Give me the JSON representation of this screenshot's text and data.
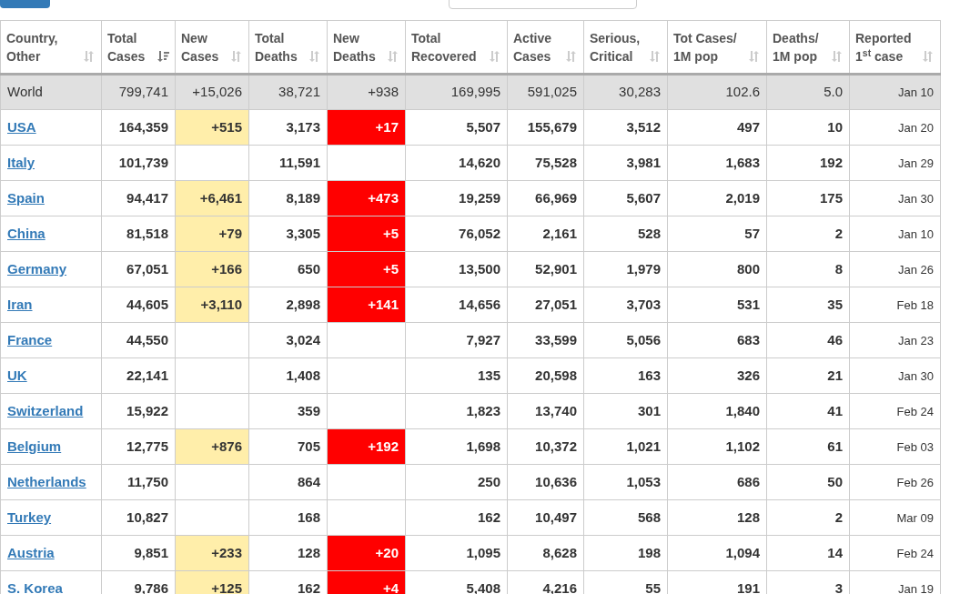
{
  "table": {
    "columns": [
      {
        "label": "Country,\nOther",
        "sorted": false
      },
      {
        "label": "Total\nCases",
        "sorted": true
      },
      {
        "label": "New\nCases",
        "sorted": false
      },
      {
        "label": "Total\nDeaths",
        "sorted": false
      },
      {
        "label": "New\nDeaths",
        "sorted": false
      },
      {
        "label": "Total\nRecovered",
        "sorted": false
      },
      {
        "label": "Active\nCases",
        "sorted": false
      },
      {
        "label": "Serious,\nCritical",
        "sorted": false
      },
      {
        "label": "Tot Cases/\n1M pop",
        "sorted": false
      },
      {
        "label": "Deaths/\n1M pop",
        "sorted": false
      },
      {
        "label": "Reported\n1$^{st}$ case",
        "sorted": false
      }
    ],
    "rows": [
      {
        "kind": "total",
        "cells": [
          "World",
          "799,741",
          "+15,026",
          "38,721",
          "+938",
          "169,995",
          "591,025",
          "30,283",
          "102.6",
          "5.0",
          "Jan 10"
        ]
      },
      {
        "kind": "country",
        "cells": [
          "USA",
          "164,359",
          "+515",
          "3,173",
          "+17",
          "5,507",
          "155,679",
          "3,512",
          "497",
          "10",
          "Jan 20"
        ]
      },
      {
        "kind": "country",
        "cells": [
          "Italy",
          "101,739",
          null,
          "11,591",
          null,
          "14,620",
          "75,528",
          "3,981",
          "1,683",
          "192",
          "Jan 29"
        ]
      },
      {
        "kind": "country",
        "cells": [
          "Spain",
          "94,417",
          "+6,461",
          "8,189",
          "+473",
          "19,259",
          "66,969",
          "5,607",
          "2,019",
          "175",
          "Jan 30"
        ]
      },
      {
        "kind": "country",
        "cells": [
          "China",
          "81,518",
          "+79",
          "3,305",
          "+5",
          "76,052",
          "2,161",
          "528",
          "57",
          "2",
          "Jan 10"
        ]
      },
      {
        "kind": "country",
        "cells": [
          "Germany",
          "67,051",
          "+166",
          "650",
          "+5",
          "13,500",
          "52,901",
          "1,979",
          "800",
          "8",
          "Jan 26"
        ]
      },
      {
        "kind": "country",
        "cells": [
          "Iran",
          "44,605",
          "+3,110",
          "2,898",
          "+141",
          "14,656",
          "27,051",
          "3,703",
          "531",
          "35",
          "Feb 18"
        ]
      },
      {
        "kind": "country",
        "cells": [
          "France",
          "44,550",
          null,
          "3,024",
          null,
          "7,927",
          "33,599",
          "5,056",
          "683",
          "46",
          "Jan 23"
        ]
      },
      {
        "kind": "country",
        "cells": [
          "UK",
          "22,141",
          null,
          "1,408",
          null,
          "135",
          "20,598",
          "163",
          "326",
          "21",
          "Jan 30"
        ]
      },
      {
        "kind": "country",
        "cells": [
          "Switzerland",
          "15,922",
          null,
          "359",
          null,
          "1,823",
          "13,740",
          "301",
          "1,840",
          "41",
          "Feb 24"
        ]
      },
      {
        "kind": "country",
        "cells": [
          "Belgium",
          "12,775",
          "+876",
          "705",
          "+192",
          "1,698",
          "10,372",
          "1,021",
          "1,102",
          "61",
          "Feb 03"
        ]
      },
      {
        "kind": "country",
        "cells": [
          "Netherlands",
          "11,750",
          null,
          "864",
          null,
          "250",
          "10,636",
          "1,053",
          "686",
          "50",
          "Feb 26"
        ]
      },
      {
        "kind": "country",
        "cells": [
          "Turkey",
          "10,827",
          null,
          "168",
          null,
          "162",
          "10,497",
          "568",
          "128",
          "2",
          "Mar 09"
        ]
      },
      {
        "kind": "country",
        "cells": [
          "Austria",
          "9,851",
          "+233",
          "128",
          "+20",
          "1,095",
          "8,628",
          "198",
          "1,094",
          "14",
          "Feb 24"
        ]
      },
      {
        "kind": "country",
        "cells": [
          "S. Korea",
          "9,786",
          "+125",
          "162",
          "+4",
          "5,408",
          "4,216",
          "55",
          "191",
          "3",
          "Jan 19"
        ]
      }
    ]
  }
}
